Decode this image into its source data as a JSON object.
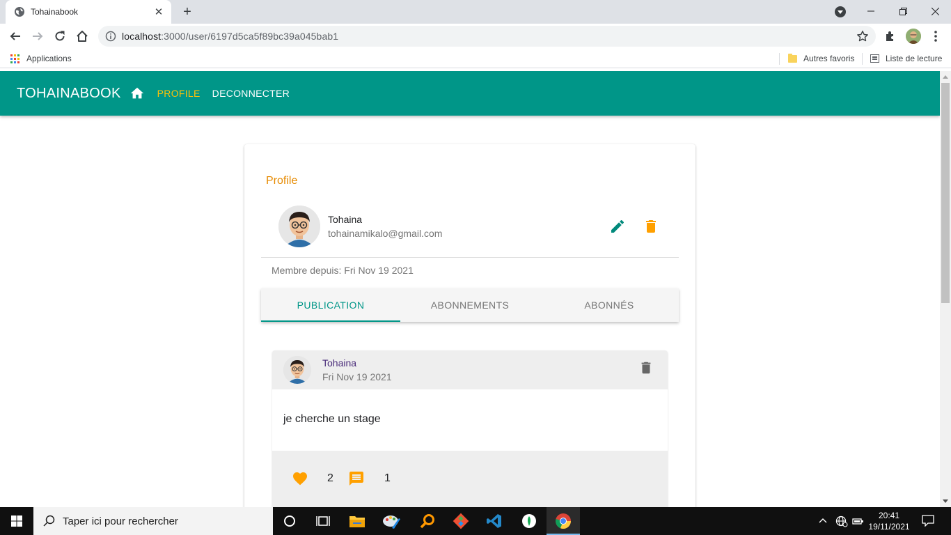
{
  "browser": {
    "tab_title": "Tohainabook",
    "new_tab_label": "+",
    "url_host": "localhost",
    "url_rest": ":3000/user/6197d5ca5f89bc39a045bab1",
    "bookmarks": {
      "apps_label": "Applications",
      "other_favorites": "Autres favoris",
      "reading_list": "Liste de lecture"
    }
  },
  "app": {
    "brand": "TOHAINABOOK",
    "nav": {
      "profile": "PROFILE",
      "logout": "DECONNECTER"
    },
    "colors": {
      "primary": "#009688",
      "accent": "#ffc107",
      "title": "#e68a00"
    }
  },
  "profile": {
    "title": "Profile",
    "name": "Tohaina",
    "email": "tohainamikalo@gmail.com",
    "member_since": "Membre depuis: Fri Nov 19 2021",
    "tabs": [
      {
        "label": "PUBLICATION",
        "active": true
      },
      {
        "label": "ABONNEMENTS",
        "active": false
      },
      {
        "label": "ABONNÉS",
        "active": false
      }
    ]
  },
  "post": {
    "author": "Tohaina",
    "date": "Fri Nov 19 2021",
    "body": "je cherche un stage",
    "likes": "2",
    "comments": "1"
  },
  "taskbar": {
    "search_placeholder": "Taper ici pour rechercher",
    "time": "20:41",
    "date": "19/11/2021",
    "apps": [
      "task-view-icon",
      "file-explorer-icon",
      "paint-icon",
      "search-app-icon",
      "git-icon",
      "vscode-icon",
      "mongodb-icon",
      "chrome-icon"
    ]
  }
}
